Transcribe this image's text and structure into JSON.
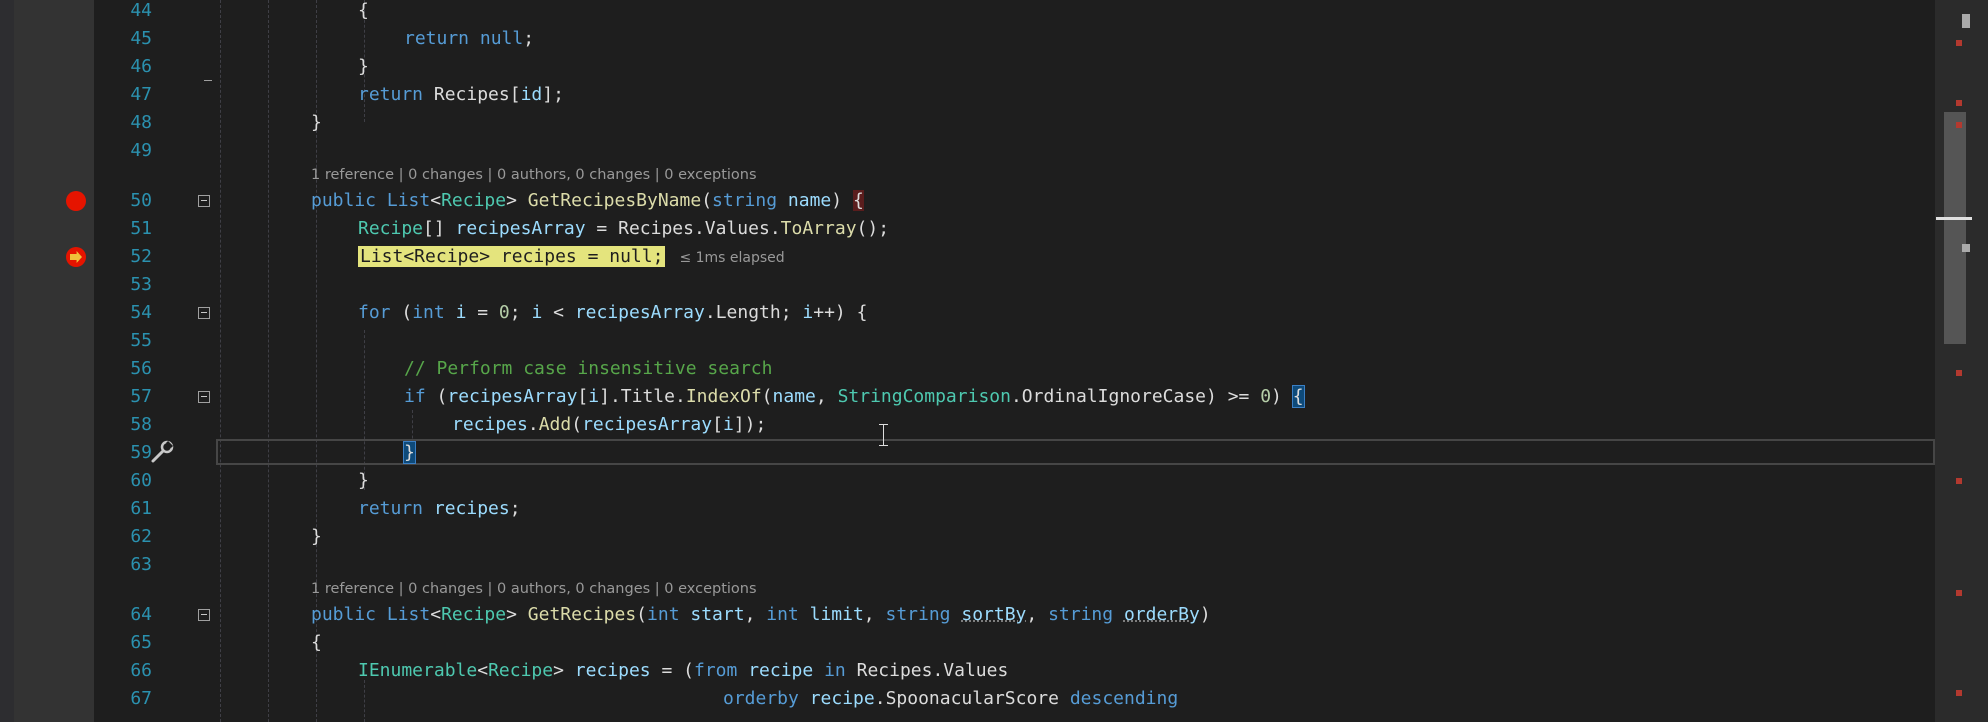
{
  "editor": {
    "lines": [
      {
        "num": "44",
        "code": "{"
      },
      {
        "num": "45",
        "code": "return null;"
      },
      {
        "num": "46",
        "code": "}"
      },
      {
        "num": "47",
        "code": "return Recipes[id];"
      },
      {
        "num": "48",
        "code": "}"
      },
      {
        "num": "49",
        "code": ""
      },
      {
        "num": "50",
        "code": "public List<Recipe> GetRecipesByName(string name) {"
      },
      {
        "num": "51",
        "code": "Recipe[] recipesArray = Recipes.Values.ToArray();"
      },
      {
        "num": "52",
        "code": "List<Recipe> recipes = null;"
      },
      {
        "num": "53",
        "code": ""
      },
      {
        "num": "54",
        "code": "for (int i = 0; i < recipesArray.Length; i++) {"
      },
      {
        "num": "55",
        "code": ""
      },
      {
        "num": "56",
        "code": "// Perform case insensitive search"
      },
      {
        "num": "57",
        "code": "if (recipesArray[i].Title.IndexOf(name, StringComparison.OrdinalIgnoreCase) >= 0) {"
      },
      {
        "num": "58",
        "code": "recipes.Add(recipesArray[i]);"
      },
      {
        "num": "59",
        "code": "}"
      },
      {
        "num": "60",
        "code": "}"
      },
      {
        "num": "61",
        "code": "return recipes;"
      },
      {
        "num": "62",
        "code": "}"
      },
      {
        "num": "63",
        "code": ""
      },
      {
        "num": "64",
        "code": "public List<Recipe> GetRecipes(int start, int limit, string sortBy, string orderBy)"
      },
      {
        "num": "65",
        "code": "{"
      },
      {
        "num": "66",
        "code": "IEnumerable<Recipe> recipes = (from recipe in Recipes.Values"
      },
      {
        "num": "67",
        "code": "orderby recipe.SpoonacularScore descending"
      }
    ],
    "codelens": [
      "1 reference | 0 changes | 0 authors, 0 changes | 0 exceptions",
      "1 reference | 0 changes | 0 authors, 0 changes | 0 exceptions"
    ],
    "elapsed_tip": "≤ 1ms elapsed",
    "breakpoint_line": "50",
    "current_statement_line": "52",
    "cursor_line": "59"
  },
  "colors": {
    "background": "#1e1e1e",
    "keyword": "#569cd6",
    "type": "#4ec9b0",
    "method": "#dcdcaa",
    "comment": "#57a64a",
    "line_number": "#2b91af",
    "breakpoint": "#e51400",
    "current_statement": "#e4e47d"
  },
  "icons": [
    "breakpoint-icon",
    "breakpoint-arrow-icon",
    "fold-icon",
    "quick-actions-wrench-icon",
    "ibeam-cursor-icon"
  ]
}
